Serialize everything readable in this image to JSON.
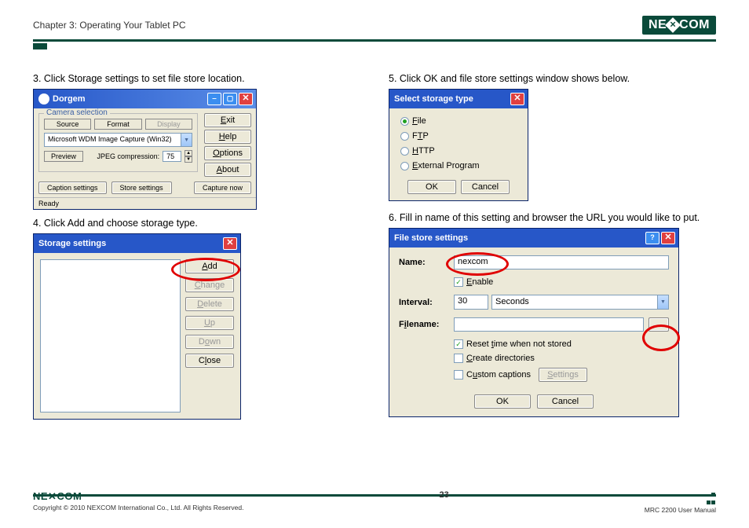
{
  "header": {
    "chapter": "Chapter 3: Operating Your Tablet PC",
    "logo_text": "NE COM",
    "logo_x": "✕"
  },
  "steps": {
    "s3": "3. Click Storage settings to set file store location.",
    "s4": "4. Click Add and choose storage type.",
    "s5": "5. Click OK and file store settings window shows below.",
    "s6": "6. Fill in name of this setting and browser the URL you would like to put."
  },
  "dorgem": {
    "title": "Dorgem",
    "camera_selection_label": "Camera selection",
    "source_btn": "Source",
    "format_btn": "Format",
    "display_btn": "Display",
    "device": "Microsoft WDM Image Capture (Win32)",
    "preview_btn": "Preview",
    "jpeg_label": "JPEG compression:",
    "jpeg_value": "75",
    "caption_settings_btn": "Caption settings",
    "store_settings_btn": "Store settings",
    "capture_now_btn": "Capture now",
    "side_exit": "Exit",
    "side_help": "Help",
    "side_options": "Options",
    "side_about": "About",
    "status": "Ready"
  },
  "storage": {
    "title": "Storage settings",
    "add": "Add",
    "change": "Change",
    "delete": "Delete",
    "up": "Up",
    "down": "Down",
    "close": "Close"
  },
  "select_type": {
    "title": "Select storage type",
    "file": "File",
    "ftp": "FTP",
    "http": "HTTP",
    "external": "External Program",
    "ok": "OK",
    "cancel": "Cancel"
  },
  "file_store": {
    "title": "File store settings",
    "name_label": "Name:",
    "name_value": "nexcom",
    "enable": "Enable",
    "interval_label": "Interval:",
    "interval_value": "30",
    "interval_unit": "Seconds",
    "filename_label": "Filename:",
    "filename_value": "",
    "browse": "...",
    "reset_time": "Reset time when not stored",
    "create_dirs": "Create directories",
    "custom_captions": "Custom captions",
    "settings_btn": "Settings",
    "ok": "OK",
    "cancel": "Cancel"
  },
  "footer": {
    "logo": "NE COM",
    "copyright": "Copyright © 2010 NEXCOM International Co., Ltd. All Rights Reserved.",
    "page": "23",
    "manual": "MRC 2200 User Manual"
  }
}
